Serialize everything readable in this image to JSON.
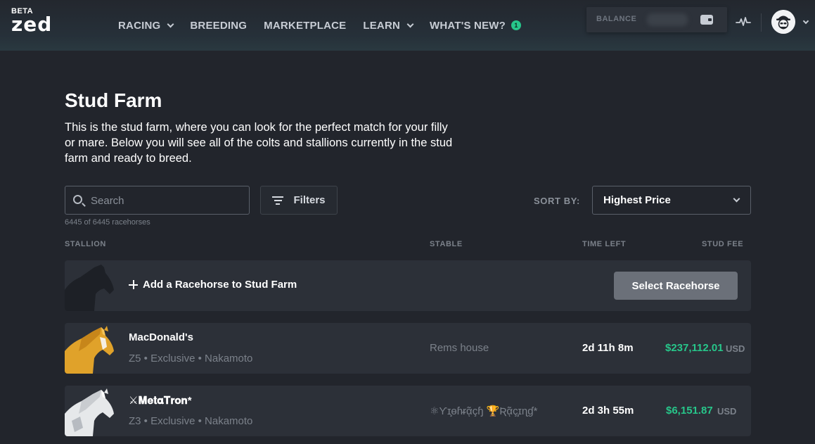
{
  "header": {
    "beta": "BETA",
    "logo": "zed",
    "nav": [
      {
        "label": "RACING",
        "dropdown": true
      },
      {
        "label": "BREEDING",
        "dropdown": false
      },
      {
        "label": "MARKETPLACE",
        "dropdown": false
      },
      {
        "label": "LEARN",
        "dropdown": true
      },
      {
        "label": "WHAT'S NEW?",
        "dropdown": false,
        "badge": "1"
      }
    ],
    "balance_label": "BALANCE",
    "icons": {
      "wallet": "wallet-icon",
      "activity": "activity-pulse-icon",
      "avatar": "avatar-icon"
    }
  },
  "page": {
    "title": "Stud Farm",
    "description": "This is the stud farm, where you can look for the perfect match for your filly or mare. Below you will see all of the colts and stallions currently in the stud farm and ready to breed."
  },
  "search": {
    "placeholder": "Search",
    "value": ""
  },
  "filters_label": "Filters",
  "result_count": "6445 of 6445 racehorses",
  "sort": {
    "label": "SORT BY:",
    "value": "Highest Price"
  },
  "columns": [
    "STALLION",
    "STABLE",
    "TIME LEFT",
    "STUD FEE"
  ],
  "add_row": {
    "label": "Add a Racehorse to Stud Farm",
    "button": "Select Racehorse"
  },
  "horses": [
    {
      "name": "MacDonald's",
      "meta": "Z5 • Exclusive • Nakamoto",
      "stable": "Rems house",
      "time_left": "2d 11h 8m",
      "fee": "$237,112.01",
      "currency": "USD",
      "coat": "#e0a22a"
    },
    {
      "name": "⚔𝐌𝐞𝐭𝛂𝐓𝐫𝐨𝐧*",
      "meta": "Z3 • Exclusive • Nakamoto",
      "stable": "⚛Ƴɪ̧ɵɦᵲᾷçɧ 🏆Ʀᾷç̧ɪɳɠ*",
      "time_left": "2d 3h 55m",
      "fee": "$6,151.87",
      "currency": "USD",
      "coat": "#e6e8ea"
    }
  ],
  "colors": {
    "accent": "#27c68a",
    "background": "#22252c",
    "row": "#2c3038",
    "button": "#6b7079"
  }
}
